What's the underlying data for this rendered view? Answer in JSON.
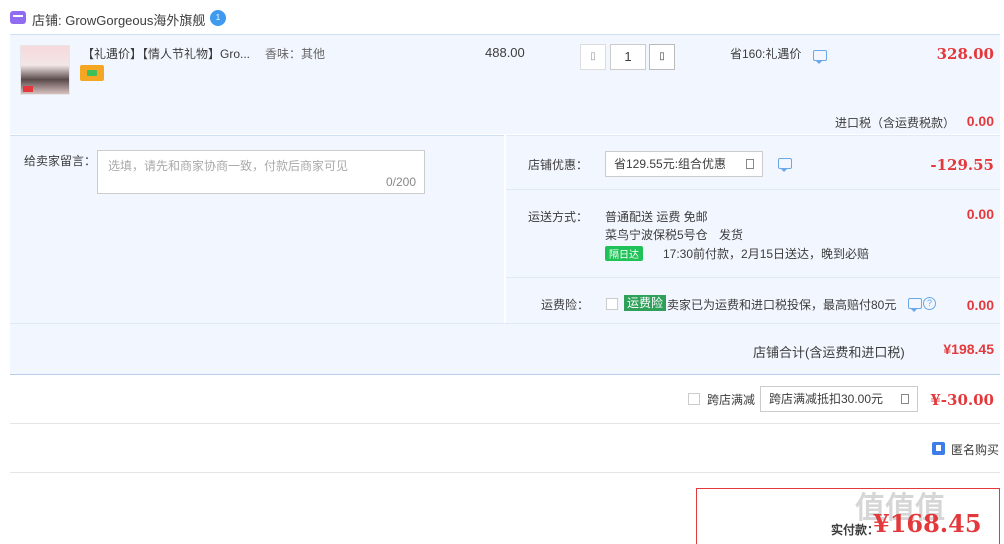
{
  "shop": {
    "label": "店铺: GrowGorgeous海外旗舰",
    "badge": "1"
  },
  "product": {
    "title": "【礼遇价】【情人节礼物】Gro...",
    "sku": "香味：其他",
    "unit_price": "488.00",
    "qty_minus": "▯",
    "qty": "1",
    "qty_plus": "▯",
    "promo": "省160:礼遇价",
    "line_total": "328.00",
    "tax_label": "进口税（含运费税款）",
    "tax_value": "0.00"
  },
  "message": {
    "label": "给卖家留言：",
    "placeholder": "选填，请先和商家协商一致，付款后商家可见",
    "count": "0/200"
  },
  "discount": {
    "label": "店铺优惠：",
    "selected": "省129.55元:组合优惠",
    "value": "-129.55"
  },
  "shipping": {
    "label": "运送方式：",
    "method": "普通配送 运费 免邮",
    "warehouse": "菜鸟宁波保税5号仓",
    "ship_note": "发货",
    "badge": "隔日达",
    "delivery": "17:30前付款，2月15日送达，晚到必赔",
    "value": "0.00"
  },
  "insurance": {
    "label": "运费险：",
    "badge": "运费险",
    "desc": "卖家已为运费和进口税投保，最高赔付80元",
    "help": "?",
    "value": "0.00"
  },
  "shop_total": {
    "label": "店铺合计(含运费和进口税)",
    "value": "¥198.45"
  },
  "cross_store": {
    "label": "跨店满减",
    "selected": "跨店满减抵扣30.00元",
    "value": "¥-30.00"
  },
  "anonymous": {
    "label": "匿名购买"
  },
  "payment": {
    "label": "实付款：",
    "value": "¥168.45"
  }
}
